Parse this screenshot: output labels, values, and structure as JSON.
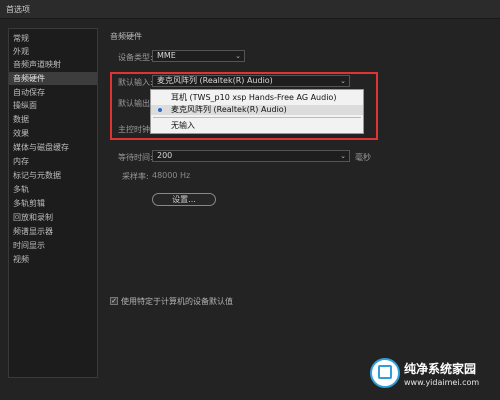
{
  "window": {
    "title": "首选项"
  },
  "sidebar": {
    "items": [
      {
        "label": "常规"
      },
      {
        "label": "外观"
      },
      {
        "label": "音频声道映射"
      },
      {
        "label": "音频硬件",
        "selected": true
      },
      {
        "label": "自动保存"
      },
      {
        "label": "操纵面"
      },
      {
        "label": "数据"
      },
      {
        "label": "效果"
      },
      {
        "label": "媒体与磁盘缓存"
      },
      {
        "label": "内存"
      },
      {
        "label": "标记与元数据"
      },
      {
        "label": "多轨"
      },
      {
        "label": "多轨剪辑"
      },
      {
        "label": "回放和录制"
      },
      {
        "label": "频谱显示器"
      },
      {
        "label": "时间显示"
      },
      {
        "label": "视频"
      }
    ]
  },
  "main": {
    "section_title": "音频硬件",
    "device_type_label": "设备类型:",
    "device_type_value": "MME",
    "default_input_label": "默认输入:",
    "default_input_value": "麦克风阵列 (Realtek(R) Audio)",
    "default_output_label": "默认输出:",
    "master_clock_label": "主控时钟:",
    "input_options": [
      {
        "label": "耳机 (TWS_p10 xsp Hands-Free AG Audio)",
        "selected": false
      },
      {
        "label": "麦克风阵列 (Realtek(R) Audio)",
        "selected": true
      },
      {
        "label": "无输入",
        "selected": false
      }
    ],
    "latency_label": "等待时间:",
    "latency_value": "200",
    "latency_unit": "毫秒",
    "sample_rate_label": "采样率:",
    "sample_rate_value": "48000 Hz",
    "settings_button": "设置...",
    "checkbox_label": "使用特定于计算机的设备默认值",
    "checkbox_checked": true
  },
  "watermark": {
    "line1": "纯净系统家园",
    "line2": "www.yidaimei.com"
  },
  "colors": {
    "highlight": "#e03333",
    "background": "#232323",
    "accent": "#2f9fd8"
  }
}
